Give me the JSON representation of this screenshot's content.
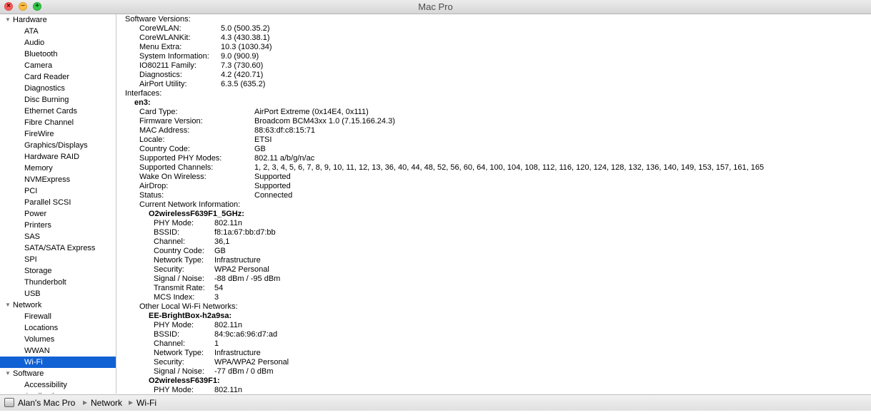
{
  "window": {
    "title": "Mac Pro"
  },
  "sidebar": {
    "groups": [
      {
        "label": "Hardware",
        "items": [
          "ATA",
          "Audio",
          "Bluetooth",
          "Camera",
          "Card Reader",
          "Diagnostics",
          "Disc Burning",
          "Ethernet Cards",
          "Fibre Channel",
          "FireWire",
          "Graphics/Displays",
          "Hardware RAID",
          "Memory",
          "NVMExpress",
          "PCI",
          "Parallel SCSI",
          "Power",
          "Printers",
          "SAS",
          "SATA/SATA Express",
          "SPI",
          "Storage",
          "Thunderbolt",
          "USB"
        ]
      },
      {
        "label": "Network",
        "items": [
          "Firewall",
          "Locations",
          "Volumes",
          "WWAN",
          "Wi-Fi"
        ]
      },
      {
        "label": "Software",
        "items": [
          "Accessibility",
          "Applications"
        ]
      }
    ],
    "selected": "Wi-Fi"
  },
  "content": {
    "software_versions_heading": "Software Versions:",
    "software_versions": [
      {
        "k": "CoreWLAN:",
        "v": "5.0 (500.35.2)"
      },
      {
        "k": "CoreWLANKit:",
        "v": "4.3 (430.38.1)"
      },
      {
        "k": "Menu Extra:",
        "v": "10.3 (1030.34)"
      },
      {
        "k": "System Information:",
        "v": "9.0 (900.9)"
      },
      {
        "k": "IO80211 Family:",
        "v": "7.3 (730.60)"
      },
      {
        "k": "Diagnostics:",
        "v": "4.2 (420.71)"
      },
      {
        "k": "AirPort Utility:",
        "v": "6.3.5 (635.2)"
      }
    ],
    "interfaces_heading": "Interfaces:",
    "interface_name": "en3:",
    "interface_props": [
      {
        "k": "Card Type:",
        "v": "AirPort Extreme  (0x14E4, 0x111)"
      },
      {
        "k": "Firmware Version:",
        "v": "Broadcom BCM43xx 1.0 (7.15.166.24.3)"
      },
      {
        "k": "MAC Address:",
        "v": "88:63:df:c8:15:71"
      },
      {
        "k": "Locale:",
        "v": "ETSI"
      },
      {
        "k": "Country Code:",
        "v": "GB"
      },
      {
        "k": "Supported PHY Modes:",
        "v": "802.11 a/b/g/n/ac"
      },
      {
        "k": "Supported Channels:",
        "v": "1, 2, 3, 4, 5, 6, 7, 8, 9, 10, 11, 12, 13, 36, 40, 44, 48, 52, 56, 60, 64, 100, 104, 108, 112, 116, 120, 124, 128, 132, 136, 140, 149, 153, 157, 161, 165"
      },
      {
        "k": "Wake On Wireless:",
        "v": "Supported"
      },
      {
        "k": "AirDrop:",
        "v": "Supported"
      },
      {
        "k": "Status:",
        "v": "Connected"
      }
    ],
    "current_network_heading": "Current Network Information:",
    "current_network_name": "O2wirelessF639F1_5GHz:",
    "current_network_props": [
      {
        "k": "PHY Mode:",
        "v": "802.11n"
      },
      {
        "k": "BSSID:",
        "v": "f8:1a:67:bb:d7:bb"
      },
      {
        "k": "Channel:",
        "v": "36,1"
      },
      {
        "k": "Country Code:",
        "v": "GB"
      },
      {
        "k": "Network Type:",
        "v": "Infrastructure"
      },
      {
        "k": "Security:",
        "v": "WPA2 Personal"
      },
      {
        "k": "Signal / Noise:",
        "v": "-88 dBm / -95 dBm"
      },
      {
        "k": "Transmit Rate:",
        "v": "54"
      },
      {
        "k": "MCS Index:",
        "v": "3"
      }
    ],
    "other_networks_heading": "Other Local Wi-Fi Networks:",
    "other_network_1_name": "EE-BrightBox-h2a9sa:",
    "other_network_1_props": [
      {
        "k": "PHY Mode:",
        "v": "802.11n"
      },
      {
        "k": "BSSID:",
        "v": "84:9c:a6:96:d7:ad"
      },
      {
        "k": "Channel:",
        "v": "1"
      },
      {
        "k": "Network Type:",
        "v": "Infrastructure"
      },
      {
        "k": "Security:",
        "v": "WPA/WPA2 Personal"
      },
      {
        "k": "Signal / Noise:",
        "v": "-77 dBm / 0 dBm"
      }
    ],
    "other_network_2_name": "O2wirelessF639F1:",
    "other_network_2_props": [
      {
        "k": "PHY Mode:",
        "v": "802.11n"
      }
    ]
  },
  "statusbar": {
    "breadcrumbs": [
      "Alan's Mac Pro",
      "Network",
      "Wi-Fi"
    ]
  }
}
